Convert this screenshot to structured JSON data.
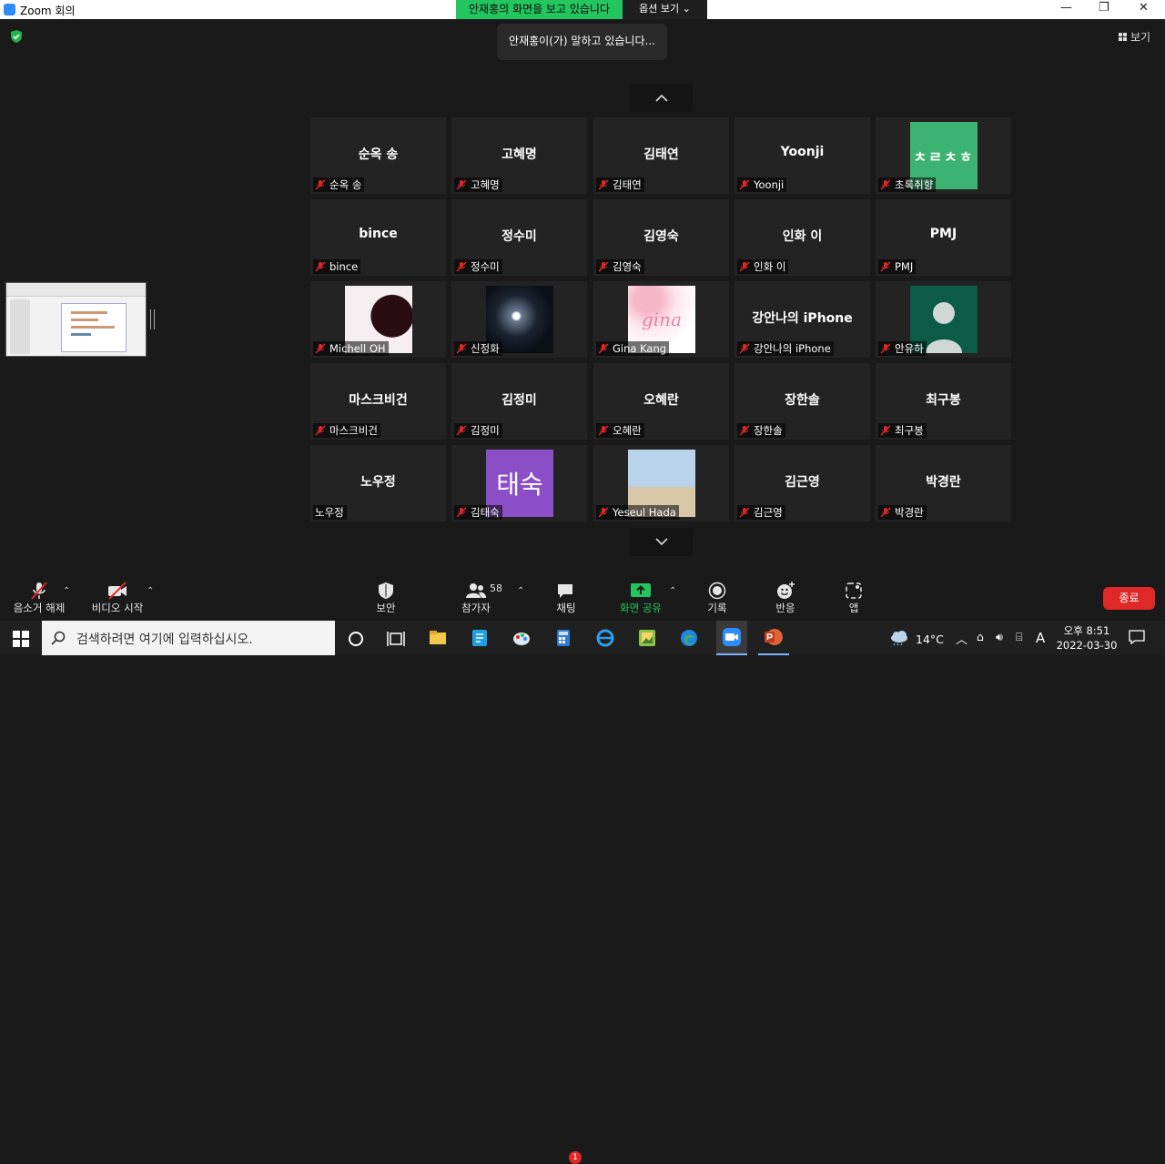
{
  "window": {
    "title": "Zoom 회의"
  },
  "share_banner": "안재홍의 화면을 보고 있습니다",
  "view_options": "옵션 보기",
  "talking_notice": "안재홍이(가) 말하고 있습니다...",
  "view_button": "보기",
  "participants": [
    {
      "big": "순옥 송",
      "name": "순옥 송"
    },
    {
      "big": "고혜명",
      "name": "고혜명"
    },
    {
      "big": "김태연",
      "name": "김태연"
    },
    {
      "big": "Yoonji",
      "name": "Yoonji"
    },
    {
      "big": "ㅊㄹㅊㅎ",
      "name": "초록취향"
    },
    {
      "big": "bince",
      "name": "bince"
    },
    {
      "big": "정수미",
      "name": "정수미"
    },
    {
      "big": "김영숙",
      "name": "김영숙"
    },
    {
      "big": "인화 이",
      "name": "인화 이"
    },
    {
      "big": "PMJ",
      "name": "PMJ"
    },
    {
      "big": "",
      "name": "Michell OH"
    },
    {
      "big": "",
      "name": "신정화"
    },
    {
      "big": "",
      "name": "Gina Kang"
    },
    {
      "big": "강안나의 iPhone",
      "name": "강안나의 iPhone"
    },
    {
      "big": "",
      "name": "안유하"
    },
    {
      "big": "마스크비건",
      "name": "마스크비건"
    },
    {
      "big": "김정미",
      "name": "김정미"
    },
    {
      "big": "오혜란",
      "name": "오혜란"
    },
    {
      "big": "장한솔",
      "name": "장한솔"
    },
    {
      "big": "최구봉",
      "name": "최구봉"
    },
    {
      "big": "노우정",
      "name": "노우정"
    },
    {
      "big": "태숙",
      "name": "김태숙"
    },
    {
      "big": "",
      "name": "Yeseul Hada"
    },
    {
      "big": "김근영",
      "name": "김근영"
    },
    {
      "big": "박경란",
      "name": "박경란"
    }
  ],
  "gina_logo": "gina",
  "toolbar": {
    "unmute": "음소거 해제",
    "start_video": "비디오 시작",
    "security": "보안",
    "participants": "참가자",
    "participant_count": "58",
    "chat": "채팅",
    "chat_badge": "1",
    "share_screen": "화면 공유",
    "record": "기록",
    "reactions": "반응",
    "apps": "앱",
    "end": "종료"
  },
  "taskbar": {
    "search_placeholder": "검색하려면 여기에 입력하십시오.",
    "temperature": "14°C",
    "ime": "A",
    "ampm_time": "오후 8:51",
    "date": "2022-03-30"
  },
  "colors": {
    "share_green": "#22c55e",
    "end_red": "#e02828",
    "tile_bg": "#232323",
    "mute_red": "#e02828"
  }
}
